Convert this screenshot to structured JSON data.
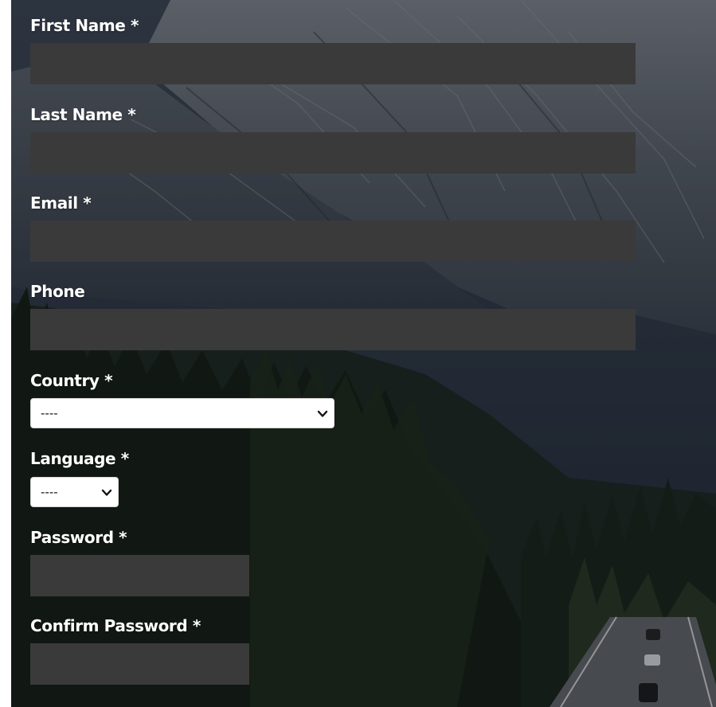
{
  "form": {
    "first_name": {
      "label": "First Name *",
      "value": ""
    },
    "last_name": {
      "label": "Last Name *",
      "value": ""
    },
    "email": {
      "label": "Email *",
      "value": ""
    },
    "phone": {
      "label": "Phone",
      "value": ""
    },
    "country": {
      "label": "Country *",
      "selected": "----"
    },
    "language": {
      "label": "Language *",
      "selected": "----"
    },
    "password": {
      "label": "Password *",
      "value": ""
    },
    "confirm_password": {
      "label": "Confirm Password *",
      "value": ""
    }
  },
  "colors": {
    "input_background": "#3a3a3a",
    "label_text": "#ffffff",
    "select_background": "#ffffff",
    "sky": "#2a3340"
  },
  "background_image": {
    "icon": "mountain-forest-road-photo"
  }
}
